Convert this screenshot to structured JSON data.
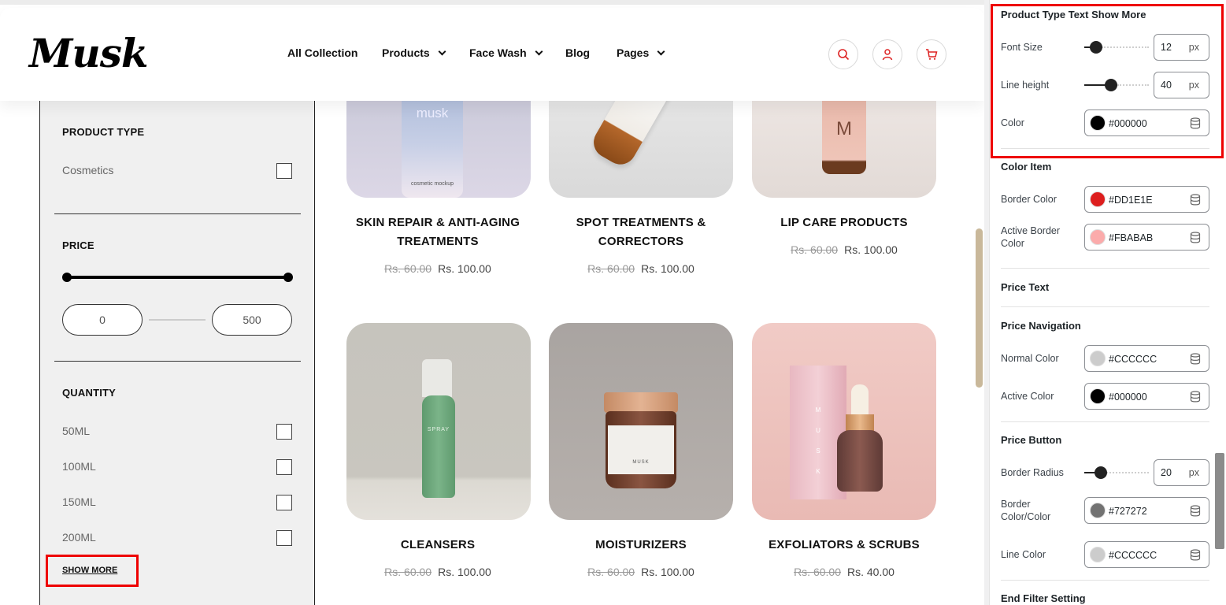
{
  "site": {
    "logo": "Musk",
    "nav": [
      "All Collection",
      "Products",
      "Face Wash",
      "Blog",
      "Pages"
    ]
  },
  "filters": {
    "product_type_title": "PRODUCT TYPE",
    "product_type_options": [
      "Cosmetics"
    ],
    "price_title": "PRICE",
    "price_min": "0",
    "price_max": "500",
    "quantity_title": "QUANTITY",
    "quantity_options": [
      "50ML",
      "100ML",
      "150ML",
      "200ML"
    ],
    "show_more": "SHOW MORE"
  },
  "products": [
    {
      "name": "SKIN REPAIR & ANTI-AGING TREATMENTS",
      "old_price": "Rs. 60.00",
      "price": "Rs. 100.00"
    },
    {
      "name": "SPOT TREATMENTS & CORRECTORS",
      "old_price": "Rs. 60.00",
      "price": "Rs. 100.00"
    },
    {
      "name": "LIP CARE PRODUCTS",
      "old_price": "Rs. 60.00",
      "price": "Rs. 100.00"
    },
    {
      "name": "CLEANSERS",
      "old_price": "Rs. 60.00",
      "price": "Rs. 100.00"
    },
    {
      "name": "MOISTURIZERS",
      "old_price": "Rs. 60.00",
      "price": "Rs. 100.00"
    },
    {
      "name": "EXFOLIATORS & SCRUBS",
      "old_price": "Rs. 60.00",
      "price": "Rs. 40.00"
    }
  ],
  "product_labels": {
    "bottle_1_brand": "musk",
    "bottle_1_caption": "cosmetic mockup",
    "bottle_3_letter": "M",
    "cleanser_label": "SPRAY",
    "jar_label": "MUSK",
    "box_letters": "M U S K"
  },
  "panel": {
    "product_type_text_show_more": {
      "title": "Product Type Text Show More",
      "font_size_label": "Font Size",
      "font_size": "12",
      "font_size_unit": "px",
      "font_size_level": 0.18,
      "line_height_label": "Line height",
      "line_height": "40",
      "line_height_unit": "px",
      "line_height_level": 0.42,
      "color_label": "Color",
      "color": "#000000"
    },
    "color_item": {
      "title": "Color Item",
      "border_color_label": "Border Color",
      "border_color": "#DD1E1E",
      "active_border_color_label": "Active Border Color",
      "active_border_color": "#FBABAB"
    },
    "price_text": {
      "title": "Price Text"
    },
    "price_navigation": {
      "title": "Price Navigation",
      "normal_color_label": "Normal Color",
      "normal_color": "#CCCCCC",
      "active_color_label": "Active Color",
      "active_color": "#000000"
    },
    "price_button": {
      "title": "Price Button",
      "border_radius_label": "Border Radius",
      "border_radius": "20",
      "border_radius_unit": "px",
      "border_radius_level": 0.25,
      "border_color_label": "Border Color/Color",
      "border_color": "#727272",
      "line_color_label": "Line Color",
      "line_color": "#CCCCCC"
    },
    "end_filter_setting": {
      "title": "End Filter Setting"
    }
  },
  "colors": {
    "highlight": "#ee0000",
    "price_slider": "#000000"
  }
}
